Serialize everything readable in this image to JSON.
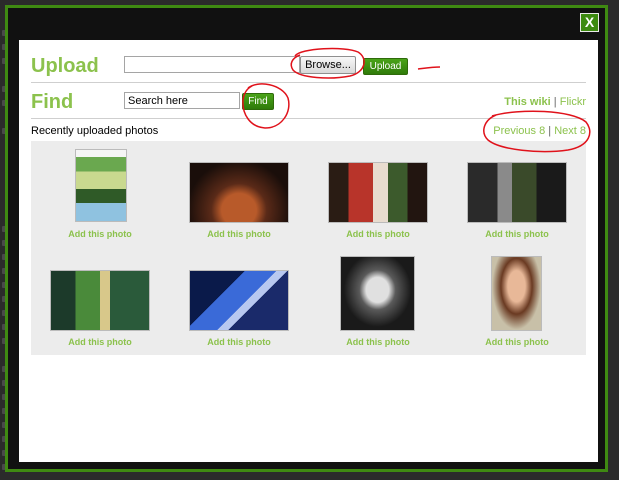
{
  "dialog": {
    "close_label": "X",
    "upload": {
      "label": "Upload",
      "browse_label": "Browse...",
      "upload_button_label": "Upload"
    },
    "find": {
      "label": "Find",
      "search_value": "Search here",
      "find_button_label": "Find",
      "source_this_wiki": "This wiki",
      "source_separator": "|",
      "source_flickr": "Flickr"
    },
    "recent": {
      "title": "Recently uploaded photos",
      "previous_label": "Previous 8",
      "separator": "|",
      "next_label": "Next 8"
    },
    "photos": [
      {
        "add_label": "Add this photo"
      },
      {
        "add_label": "Add this photo"
      },
      {
        "add_label": "Add this photo"
      },
      {
        "add_label": "Add this photo"
      },
      {
        "add_label": "Add this photo"
      },
      {
        "add_label": "Add this photo"
      },
      {
        "add_label": "Add this photo"
      },
      {
        "add_label": "Add this photo"
      }
    ]
  },
  "colors": {
    "accent_green": "#8cc24d",
    "frame_green": "#3f8a12",
    "button_green": "#3d8a10",
    "annotation_red": "#e0121b"
  }
}
